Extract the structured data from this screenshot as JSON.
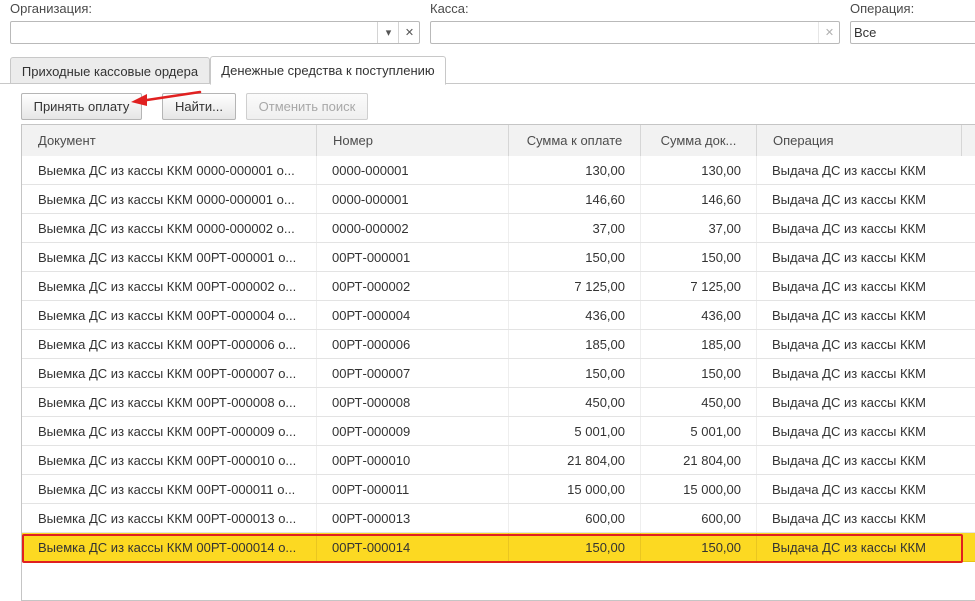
{
  "filters": {
    "organization_label": "Организация:",
    "organization_value": "",
    "kassa_label": "Касса:",
    "kassa_value": "",
    "operation_label": "Операция:",
    "operation_value": "Все"
  },
  "tabs": [
    {
      "label": "Приходные кассовые ордера",
      "active": false
    },
    {
      "label": "Денежные средства к поступлению",
      "active": true
    }
  ],
  "toolbar": {
    "accept_payment_label": "Принять оплату",
    "find_label": "Найти...",
    "cancel_search_label": "Отменить поиск"
  },
  "icons": {
    "dropdown": "chevron-down-icon",
    "clear": "close-icon",
    "annotation": "red-arrow"
  },
  "colors": {
    "selected_row": "#fcd922",
    "highlight_box": "#e02020"
  },
  "table": {
    "columns": [
      "Документ",
      "Номер",
      "Сумма к оплате",
      "Сумма док...",
      "Операция"
    ],
    "rows": [
      {
        "doc": "Выемка ДС из кассы ККМ 0000-000001 о...",
        "num": "0000-000001",
        "sum_pay": "130,00",
        "sum_doc": "130,00",
        "op": "Выдача ДС из кассы ККМ"
      },
      {
        "doc": "Выемка ДС из кассы ККМ 0000-000001 о...",
        "num": "0000-000001",
        "sum_pay": "146,60",
        "sum_doc": "146,60",
        "op": "Выдача ДС из кассы ККМ"
      },
      {
        "doc": "Выемка ДС из кассы ККМ 0000-000002 о...",
        "num": "0000-000002",
        "sum_pay": "37,00",
        "sum_doc": "37,00",
        "op": "Выдача ДС из кассы ККМ"
      },
      {
        "doc": "Выемка ДС из кассы ККМ 00РТ-000001 о...",
        "num": "00РТ-000001",
        "sum_pay": "150,00",
        "sum_doc": "150,00",
        "op": "Выдача ДС из кассы ККМ"
      },
      {
        "doc": "Выемка ДС из кассы ККМ 00РТ-000002 о...",
        "num": "00РТ-000002",
        "sum_pay": "7 125,00",
        "sum_doc": "7 125,00",
        "op": "Выдача ДС из кассы ККМ"
      },
      {
        "doc": "Выемка ДС из кассы ККМ 00РТ-000004 о...",
        "num": "00РТ-000004",
        "sum_pay": "436,00",
        "sum_doc": "436,00",
        "op": "Выдача ДС из кассы ККМ"
      },
      {
        "doc": "Выемка ДС из кассы ККМ 00РТ-000006 о...",
        "num": "00РТ-000006",
        "sum_pay": "185,00",
        "sum_doc": "185,00",
        "op": "Выдача ДС из кассы ККМ"
      },
      {
        "doc": "Выемка ДС из кассы ККМ 00РТ-000007 о...",
        "num": "00РТ-000007",
        "sum_pay": "150,00",
        "sum_doc": "150,00",
        "op": "Выдача ДС из кассы ККМ"
      },
      {
        "doc": "Выемка ДС из кассы ККМ 00РТ-000008 о...",
        "num": "00РТ-000008",
        "sum_pay": "450,00",
        "sum_doc": "450,00",
        "op": "Выдача ДС из кассы ККМ"
      },
      {
        "doc": "Выемка ДС из кассы ККМ 00РТ-000009 о...",
        "num": "00РТ-000009",
        "sum_pay": "5 001,00",
        "sum_doc": "5 001,00",
        "op": "Выдача ДС из кассы ККМ"
      },
      {
        "doc": "Выемка ДС из кассы ККМ 00РТ-000010 о...",
        "num": "00РТ-000010",
        "sum_pay": "21 804,00",
        "sum_doc": "21 804,00",
        "op": "Выдача ДС из кассы ККМ"
      },
      {
        "doc": "Выемка ДС из кассы ККМ 00РТ-000011 о...",
        "num": "00РТ-000011",
        "sum_pay": "15 000,00",
        "sum_doc": "15 000,00",
        "op": "Выдача ДС из кассы ККМ"
      },
      {
        "doc": "Выемка ДС из кассы ККМ 00РТ-000013 о...",
        "num": "00РТ-000013",
        "sum_pay": "600,00",
        "sum_doc": "600,00",
        "op": "Выдача ДС из кассы ККМ"
      },
      {
        "doc": "Выемка ДС из кассы ККМ 00РТ-000014 о...",
        "num": "00РТ-000014",
        "sum_pay": "150,00",
        "sum_doc": "150,00",
        "op": "Выдача ДС из кассы ККМ",
        "selected": true
      }
    ]
  }
}
